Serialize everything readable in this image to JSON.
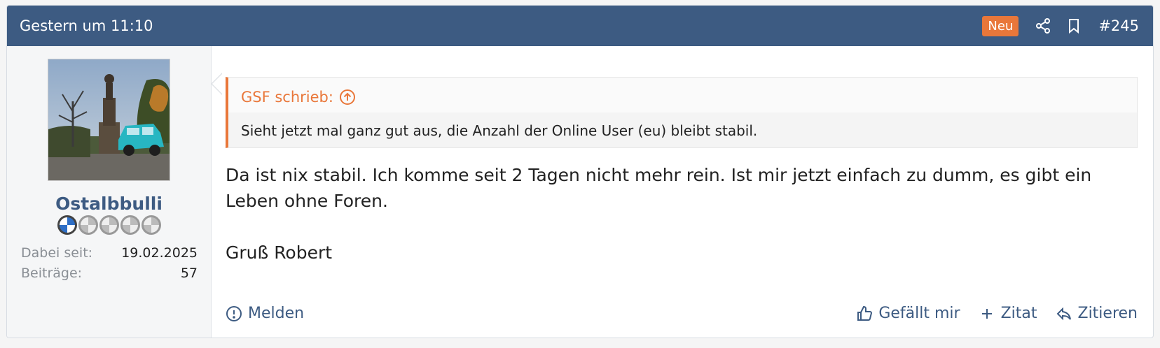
{
  "header": {
    "date": "Gestern um 11:10",
    "badge": "Neu",
    "post_number": "#245"
  },
  "user": {
    "name": "Ostalbbulli",
    "joined_label": "Dabei seit:",
    "joined_value": "19.02.2025",
    "posts_label": "Beiträge:",
    "posts_value": "57"
  },
  "quote": {
    "author": "GSF schrieb:",
    "text": "Sieht jetzt mal ganz gut aus, die Anzahl der Online User (eu) bleibt stabil."
  },
  "message": {
    "paragraph1": "Da ist nix stabil. Ich komme seit 2 Tagen nicht mehr rein. Ist mir jetzt einfach zu dumm, es gibt ein Leben ohne Foren.",
    "paragraph2": "Gruß Robert"
  },
  "actions": {
    "report": "Melden",
    "like": "Gefällt mir",
    "add_quote": "Zitat",
    "reply": "Zitieren"
  },
  "colors": {
    "header_bg": "#3d5b82",
    "accent": "#e9773a",
    "link": "#3d5b82"
  }
}
